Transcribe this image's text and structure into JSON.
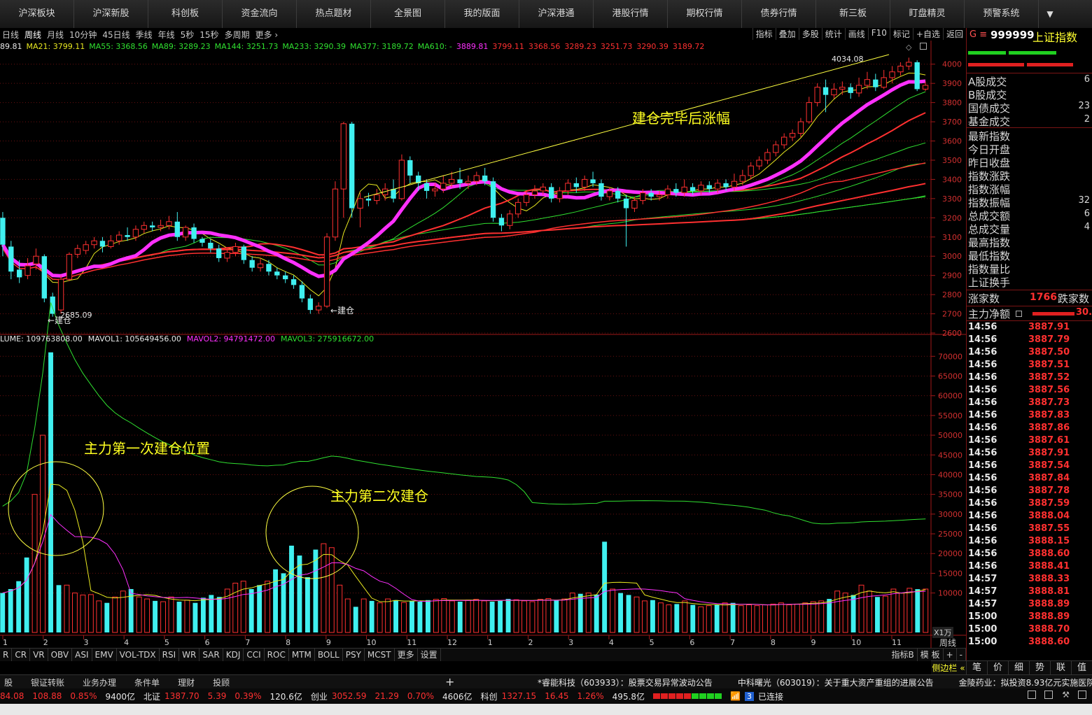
{
  "nav": [
    "沪深板块",
    "沪深新股",
    "科创板",
    "资金流向",
    "热点题材",
    "全景图",
    "我的版面",
    "沪深港通",
    "港股行情",
    "期权行情",
    "债券行情",
    "新三板",
    "盯盘精灵",
    "预警系统"
  ],
  "periods": [
    "日线",
    "周线",
    "月线",
    "10分钟",
    "45日线",
    "季线",
    "年线",
    "5秒",
    "15秒",
    "多周期",
    "更多 ›"
  ],
  "active_period": "周线",
  "tools": [
    "指标",
    "叠加",
    "多股",
    "统计",
    "画线",
    "F10",
    "标记",
    "+自选",
    "返回"
  ],
  "ma_legend": [
    {
      "text": "89.81",
      "color": "#e8e8e8"
    },
    {
      "text": "MA21: 3799.11",
      "color": "#e8e820"
    },
    {
      "text": "MA55: 3368.56",
      "color": "#30e030"
    },
    {
      "text": "MA89: 3289.23",
      "color": "#30e030"
    },
    {
      "text": "MA144: 3251.73",
      "color": "#30e030"
    },
    {
      "text": "MA233: 3290.39",
      "color": "#30e030"
    },
    {
      "text": "MA377: 3189.72",
      "color": "#30e030"
    },
    {
      "text": "MA610: -",
      "color": "#30e030"
    },
    {
      "text": "3889.81",
      "color": "#ff30ff"
    },
    {
      "text": "3799.11",
      "color": "#ff3030"
    },
    {
      "text": "3368.56",
      "color": "#ff3030"
    },
    {
      "text": "3289.23",
      "color": "#ff3030"
    },
    {
      "text": "3251.73",
      "color": "#ff3030"
    },
    {
      "text": "3290.39",
      "color": "#ff3030"
    },
    {
      "text": "3189.72",
      "color": "#ff3030"
    }
  ],
  "vol_legend": [
    {
      "text": "LUME: 109763808.00",
      "color": "#e8e8e8"
    },
    {
      "text": "MAVOL1: 105649456.00",
      "color": "#e8e8e8"
    },
    {
      "text": "MAVOL2: 94791472.00",
      "color": "#ff30ff"
    },
    {
      "text": "MAVOL3: 275916672.00",
      "color": "#30e030"
    }
  ],
  "annotations": {
    "after_build": "建仓完毕后涨幅",
    "first_build": "主力第一次建仓位置",
    "second_build": "主力第二次建仓",
    "build_left": "←建仓",
    "build_right": "←建仓",
    "low_label": "2685.09",
    "high_label": "4034.08"
  },
  "price_axis": [
    "4000",
    "3900",
    "3800",
    "3700",
    "3600",
    "3500",
    "3400",
    "3300",
    "3200",
    "3100",
    "3000",
    "2900",
    "2800",
    "2700",
    "2600"
  ],
  "vol_axis": [
    "70000",
    "65000",
    "60000",
    "55000",
    "50000",
    "45000",
    "40000",
    "35000",
    "30000",
    "25000",
    "20000",
    "15000",
    "10000"
  ],
  "vol_unit": "X1万",
  "period_label": "周线",
  "month_labels": [
    "1",
    "2",
    "3",
    "4",
    "5",
    "6",
    "7",
    "8",
    "9",
    "10",
    "11",
    "12",
    "1",
    "2",
    "3",
    "4",
    "5",
    "6",
    "7",
    "8",
    "9",
    "10",
    "11"
  ],
  "indicator_tabs": [
    "R",
    "CR",
    "VR",
    "OBV",
    "ASI",
    "EMV",
    "VOL-TDX",
    "RSI",
    "WR",
    "SAR",
    "KDJ",
    "CCI",
    "ROC",
    "MTM",
    "BOLL",
    "PSY",
    "MCST",
    "更多",
    "设置"
  ],
  "indicator_right": [
    "指标B",
    "模 板",
    "+",
    "-"
  ],
  "panel": {
    "prefix": "G ≡",
    "code": "999999",
    "name": "上证指数",
    "stats_a": [
      {
        "label": "A股成交",
        "value": "6"
      },
      {
        "label": "B股成交",
        "value": ""
      },
      {
        "label": "国债成交",
        "value": "23"
      },
      {
        "label": "基金成交",
        "value": "2"
      }
    ],
    "stats_b": [
      {
        "label": "最新指数",
        "value": ""
      },
      {
        "label": "今日开盘",
        "value": ""
      },
      {
        "label": "昨日收盘",
        "value": ""
      },
      {
        "label": "指数涨跌",
        "value": ""
      },
      {
        "label": "指数涨幅",
        "value": ""
      },
      {
        "label": "指数振幅",
        "value": "32"
      },
      {
        "label": "总成交额",
        "value": "6"
      },
      {
        "label": "总成交量",
        "value": "4"
      },
      {
        "label": "最高指数",
        "value": ""
      },
      {
        "label": "最低指数",
        "value": ""
      },
      {
        "label": "指数量比",
        "value": ""
      },
      {
        "label": "上证换手",
        "value": ""
      }
    ],
    "up_label": "涨家数",
    "up_count": "1766",
    "down_label": "跌家数",
    "flow_label": "主力净额",
    "flow_value": "30.",
    "ticks": [
      {
        "t": "14:56",
        "p": "3887.91"
      },
      {
        "t": "14:56",
        "p": "3887.79"
      },
      {
        "t": "14:56",
        "p": "3887.50"
      },
      {
        "t": "14:56",
        "p": "3887.51"
      },
      {
        "t": "14:56",
        "p": "3887.52"
      },
      {
        "t": "14:56",
        "p": "3887.56"
      },
      {
        "t": "14:56",
        "p": "3887.73"
      },
      {
        "t": "14:56",
        "p": "3887.83"
      },
      {
        "t": "14:56",
        "p": "3887.86"
      },
      {
        "t": "14:56",
        "p": "3887.61"
      },
      {
        "t": "14:56",
        "p": "3887.91"
      },
      {
        "t": "14:56",
        "p": "3887.54"
      },
      {
        "t": "14:56",
        "p": "3887.84"
      },
      {
        "t": "14:56",
        "p": "3887.78"
      },
      {
        "t": "14:56",
        "p": "3887.59"
      },
      {
        "t": "14:56",
        "p": "3888.04"
      },
      {
        "t": "14:56",
        "p": "3887.55"
      },
      {
        "t": "14:56",
        "p": "3888.15"
      },
      {
        "t": "14:56",
        "p": "3888.60"
      },
      {
        "t": "14:56",
        "p": "3888.41"
      },
      {
        "t": "14:57",
        "p": "3888.33"
      },
      {
        "t": "14:57",
        "p": "3888.81"
      },
      {
        "t": "14:57",
        "p": "3888.89"
      },
      {
        "t": "15:00",
        "p": "3888.89"
      },
      {
        "t": "15:00",
        "p": "3888.70"
      },
      {
        "t": "15:00",
        "p": "3888.60"
      }
    ],
    "sidebar_label": "侧边栏 «",
    "sidebar_tabs": [
      "笔",
      "价",
      "细",
      "势",
      "联",
      "值"
    ]
  },
  "statusbar1": {
    "items": [
      "股",
      "银证转账",
      "业务办理",
      "条件单",
      "理财",
      "投顾"
    ],
    "plus": "+",
    "news": [
      "*睿能科技（603933）：股票交易异常波动公告",
      "中科曙光（603019）：关于重大资产重组的进展公告",
      "金陵药业：拟投资8.93亿元实施医院"
    ]
  },
  "statusbar2": {
    "sh": [
      "84.08",
      "108.88",
      "0.85%",
      "9400亿"
    ],
    "bz_label": "北证",
    "bz": [
      "1387.70",
      "5.39",
      "0.39%",
      "120.6亿"
    ],
    "cy_label": "创业",
    "cy": [
      "3052.59",
      "21.29",
      "0.70%",
      "4606亿"
    ],
    "kc_label": "科创",
    "kc": [
      "1327.15",
      "16.45",
      "1.26%",
      "495.8亿"
    ],
    "conn_num": "3",
    "conn": "已连接"
  },
  "chart_data": {
    "type": "candlestick",
    "period": "weekly",
    "y_range": [
      2600,
      4050
    ],
    "vol_range_10k": [
      0,
      72000
    ],
    "candles": [
      [
        3200,
        3060,
        3230,
        3000
      ],
      [
        3050,
        2920,
        3080,
        2880
      ],
      [
        2930,
        2890,
        2980,
        2860
      ],
      [
        2900,
        2950,
        2990,
        2880
      ],
      [
        2960,
        3000,
        3040,
        2930
      ],
      [
        3000,
        2780,
        3010,
        2760
      ],
      [
        2790,
        2700,
        2810,
        2685
      ],
      [
        2720,
        2880,
        2900,
        2700
      ],
      [
        2880,
        3010,
        3020,
        2870
      ],
      [
        3010,
        3040,
        3060,
        2990
      ],
      [
        3030,
        3060,
        3080,
        3010
      ],
      [
        3060,
        3080,
        3100,
        3040
      ],
      [
        3080,
        3050,
        3100,
        3020
      ],
      [
        3050,
        3080,
        3110,
        3040
      ],
      [
        3080,
        3110,
        3130,
        3060
      ],
      [
        3110,
        3100,
        3150,
        3080
      ],
      [
        3100,
        3140,
        3160,
        3080
      ],
      [
        3140,
        3160,
        3180,
        3120
      ],
      [
        3160,
        3150,
        3180,
        3130
      ],
      [
        3150,
        3160,
        3190,
        3130
      ],
      [
        3160,
        3180,
        3210,
        3140
      ],
      [
        3180,
        3100,
        3230,
        3080
      ],
      [
        3100,
        3150,
        3160,
        3080
      ],
      [
        3150,
        3090,
        3170,
        3070
      ],
      [
        3090,
        3070,
        3100,
        3050
      ],
      [
        3070,
        3040,
        3090,
        3020
      ],
      [
        3040,
        2990,
        3060,
        2970
      ],
      [
        2990,
        3020,
        3040,
        2970
      ],
      [
        3020,
        3050,
        3070,
        3000
      ],
      [
        3050,
        2980,
        3060,
        2960
      ],
      [
        2980,
        2940,
        3000,
        2920
      ],
      [
        2940,
        2960,
        2990,
        2920
      ],
      [
        2960,
        2920,
        2980,
        2900
      ],
      [
        2920,
        2900,
        2940,
        2880
      ],
      [
        2900,
        2880,
        2920,
        2860
      ],
      [
        2880,
        2850,
        2900,
        2830
      ],
      [
        2850,
        2780,
        2870,
        2760
      ],
      [
        2780,
        2720,
        2800,
        2700
      ],
      [
        2720,
        2740,
        2760,
        2700
      ],
      [
        2740,
        3100,
        3120,
        2730
      ],
      [
        3100,
        3350,
        3390,
        3080
      ],
      [
        3350,
        3690,
        3700,
        3200
      ],
      [
        3690,
        3250,
        3700,
        3200
      ],
      [
        3250,
        3300,
        3330,
        3150
      ],
      [
        3300,
        3290,
        3330,
        3260
      ],
      [
        3290,
        3320,
        3350,
        3270
      ],
      [
        3320,
        3350,
        3380,
        3290
      ],
      [
        3350,
        3300,
        3400,
        3280
      ],
      [
        3300,
        3500,
        3530,
        3290
      ],
      [
        3500,
        3420,
        3520,
        3380
      ],
      [
        3420,
        3380,
        3440,
        3340
      ],
      [
        3380,
        3340,
        3400,
        3300
      ],
      [
        3340,
        3350,
        3380,
        3310
      ],
      [
        3350,
        3380,
        3420,
        3330
      ],
      [
        3380,
        3400,
        3440,
        3360
      ],
      [
        3400,
        3380,
        3460,
        3350
      ],
      [
        3380,
        3390,
        3420,
        3350
      ],
      [
        3390,
        3420,
        3440,
        3370
      ],
      [
        3420,
        3390,
        3460,
        3370
      ],
      [
        3390,
        3200,
        3410,
        3180
      ],
      [
        3200,
        3160,
        3220,
        3130
      ],
      [
        3160,
        3220,
        3240,
        3140
      ],
      [
        3220,
        3280,
        3300,
        3200
      ],
      [
        3280,
        3320,
        3340,
        3260
      ],
      [
        3320,
        3340,
        3370,
        3300
      ],
      [
        3340,
        3360,
        3380,
        3320
      ],
      [
        3360,
        3300,
        3380,
        3280
      ],
      [
        3300,
        3340,
        3360,
        3280
      ],
      [
        3340,
        3380,
        3400,
        3320
      ],
      [
        3380,
        3360,
        3410,
        3330
      ],
      [
        3360,
        3400,
        3420,
        3340
      ],
      [
        3400,
        3380,
        3440,
        3360
      ],
      [
        3380,
        3310,
        3400,
        3290
      ],
      [
        3310,
        3340,
        3360,
        3290
      ],
      [
        3340,
        3300,
        3360,
        3280
      ],
      [
        3300,
        3250,
        3320,
        3050
      ],
      [
        3250,
        3290,
        3310,
        3230
      ],
      [
        3290,
        3330,
        3350,
        3270
      ],
      [
        3330,
        3310,
        3350,
        3290
      ],
      [
        3310,
        3320,
        3340,
        3290
      ],
      [
        3320,
        3350,
        3370,
        3300
      ],
      [
        3350,
        3330,
        3380,
        3310
      ],
      [
        3330,
        3360,
        3400,
        3310
      ],
      [
        3360,
        3340,
        3380,
        3320
      ],
      [
        3340,
        3370,
        3390,
        3320
      ],
      [
        3370,
        3350,
        3390,
        3330
      ],
      [
        3350,
        3380,
        3400,
        3330
      ],
      [
        3380,
        3360,
        3400,
        3340
      ],
      [
        3360,
        3390,
        3430,
        3340
      ],
      [
        3390,
        3420,
        3450,
        3370
      ],
      [
        3420,
        3470,
        3490,
        3400
      ],
      [
        3470,
        3500,
        3520,
        3450
      ],
      [
        3500,
        3540,
        3560,
        3480
      ],
      [
        3540,
        3580,
        3600,
        3520
      ],
      [
        3580,
        3620,
        3640,
        3560
      ],
      [
        3620,
        3640,
        3660,
        3600
      ],
      [
        3640,
        3700,
        3720,
        3620
      ],
      [
        3700,
        3800,
        3830,
        3690
      ],
      [
        3800,
        3880,
        3900,
        3780
      ],
      [
        3880,
        3840,
        3920,
        3750
      ],
      [
        3840,
        3870,
        3900,
        3820
      ],
      [
        3870,
        3880,
        3910,
        3840
      ],
      [
        3880,
        3850,
        3900,
        3820
      ],
      [
        3850,
        3890,
        3930,
        3830
      ],
      [
        3890,
        3920,
        3960,
        3870
      ],
      [
        3920,
        3880,
        3950,
        3860
      ],
      [
        3880,
        3930,
        3970,
        3870
      ],
      [
        3930,
        3960,
        3990,
        3900
      ],
      [
        3960,
        3990,
        4010,
        3940
      ],
      [
        3990,
        4010,
        4034,
        3970
      ],
      [
        4010,
        3870,
        4020,
        3860
      ],
      [
        3870,
        3890,
        3910,
        3860
      ]
    ],
    "volumes_10k": [
      10000,
      11000,
      13000,
      19000,
      35000,
      50000,
      71000,
      12000,
      12000,
      10000,
      9500,
      9600,
      8000,
      7500,
      9000,
      10500,
      11000,
      9000,
      8500,
      8000,
      7800,
      9000,
      7800,
      8200,
      7500,
      8800,
      9500,
      9000,
      11000,
      12500,
      13000,
      11000,
      12000,
      13000,
      16000,
      15000,
      22000,
      19500,
      14000,
      21000,
      22500,
      21500,
      12000,
      8500,
      6500,
      8500,
      8000,
      7500,
      8500,
      8200,
      7600,
      8000,
      7800,
      8200,
      8400,
      8600,
      8000,
      7800,
      8200,
      8400,
      8000,
      7800,
      8000,
      8500,
      8300,
      8000,
      7800,
      8400,
      8600,
      8200,
      8500,
      10000,
      9800,
      10000,
      9600,
      23000,
      11000,
      10000,
      9500,
      9000,
      8000,
      8200,
      7500,
      7000,
      7200,
      8000,
      7000,
      6500,
      6800,
      7000,
      7500,
      7500,
      6800,
      7000,
      6800,
      7000,
      7200,
      7500,
      7000,
      7200,
      7500,
      7800,
      8000,
      8500,
      10500,
      10000,
      9500,
      12000,
      10500,
      9000,
      9200,
      11000,
      10000,
      11200,
      10976,
      11000
    ],
    "ma_lines": [
      {
        "name": "MA21",
        "color": "#e8e820",
        "width": 1
      },
      {
        "name": "MA55",
        "color": "#30e030",
        "width": 1
      },
      {
        "name": "MA89",
        "color": "#30e030",
        "width": 1
      },
      {
        "name": "MA144",
        "color": "#30e030",
        "width": 1
      },
      {
        "name": "MA233",
        "color": "#30e030",
        "width": 1
      },
      {
        "name": "MA377",
        "color": "#30e030",
        "width": 1
      }
    ],
    "colors": {
      "up": "#ff3030",
      "down": "#40f0f0",
      "grid": "#6a1010",
      "axis": "#a01818"
    }
  }
}
